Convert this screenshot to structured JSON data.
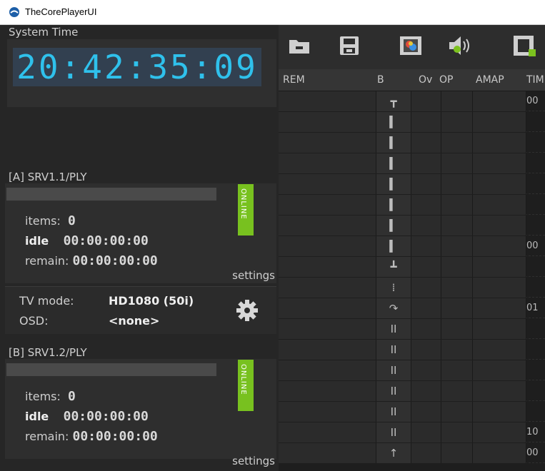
{
  "window": {
    "title": "TheCorePlayerUI"
  },
  "clock": {
    "label": "System Time",
    "value": "20:42:35:09",
    "color": "#2fc1ec"
  },
  "players": [
    {
      "name": "[A] SRV1.1/PLY",
      "status": "ONLINE",
      "items_label": "items:",
      "items_value": "0",
      "state_label": "idle",
      "state_time": "00:00:00:00",
      "remain_label": "remain:",
      "remain_time": "00:00:00:00",
      "settings_label": "settings",
      "tv_mode_label": "TV mode:",
      "tv_mode_value": "HD1080 (50i)",
      "osd_label": "OSD:",
      "osd_value": "<none>"
    },
    {
      "name": "[B] SRV1.2/PLY",
      "status": "ONLINE",
      "items_label": "items:",
      "items_value": "0",
      "state_label": "idle",
      "state_time": "00:00:00:00",
      "remain_label": "remain:",
      "remain_time": "00:00:00:00",
      "settings_label": "settings"
    }
  ],
  "toolbar": {
    "buttons": [
      "folder-icon",
      "save-icon",
      "preview-icon",
      "audio-icon",
      "clip-add-icon"
    ]
  },
  "table": {
    "columns": [
      "REM",
      "B",
      "Ov",
      "OP",
      "AMAP",
      "TIM"
    ],
    "rows": [
      {
        "b": "┳",
        "time": "00"
      },
      {
        "b": "▍",
        "time": ""
      },
      {
        "b": "▍",
        "time": ""
      },
      {
        "b": "▍",
        "time": ""
      },
      {
        "b": "▍",
        "time": ""
      },
      {
        "b": "▍",
        "time": ""
      },
      {
        "b": "▍",
        "time": ""
      },
      {
        "b": "▍",
        "time": "00"
      },
      {
        "b": "┻",
        "time": ""
      },
      {
        "b": "⁞",
        "time": ""
      },
      {
        "b": "↷",
        "time": "01"
      },
      {
        "b": "II",
        "time": ""
      },
      {
        "b": "II",
        "time": ""
      },
      {
        "b": "II",
        "time": ""
      },
      {
        "b": "II",
        "time": ""
      },
      {
        "b": "II",
        "time": ""
      },
      {
        "b": "II",
        "time": "10"
      },
      {
        "b": "↑",
        "time": "00"
      }
    ]
  },
  "colors": {
    "online": "#78c11f",
    "clock_bg": "#324050"
  }
}
